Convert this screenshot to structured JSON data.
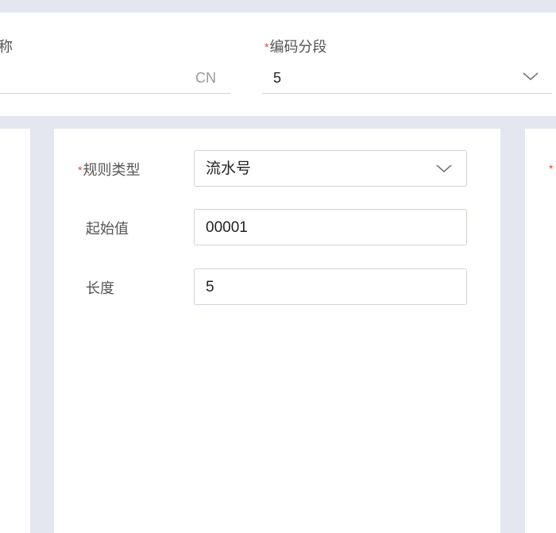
{
  "header": {
    "name_field": {
      "label_partial": "称",
      "suffix": "CN"
    },
    "segment_field": {
      "required_mark": "*",
      "label": "编码分段",
      "value": "5"
    }
  },
  "rule_panel": {
    "rule_type": {
      "required_mark": "*",
      "label": "规则类型",
      "value": "流水号"
    },
    "start_value": {
      "label": "起始值",
      "value": "00001"
    },
    "length": {
      "label": "长度",
      "value": "5"
    }
  },
  "right_panel": {
    "required_mark": "*"
  },
  "icons": {
    "dropdown": "chevron-down-icon"
  },
  "colors": {
    "required": "#e8453c",
    "background": "#e4e7ef",
    "border": "#cfd3da"
  }
}
